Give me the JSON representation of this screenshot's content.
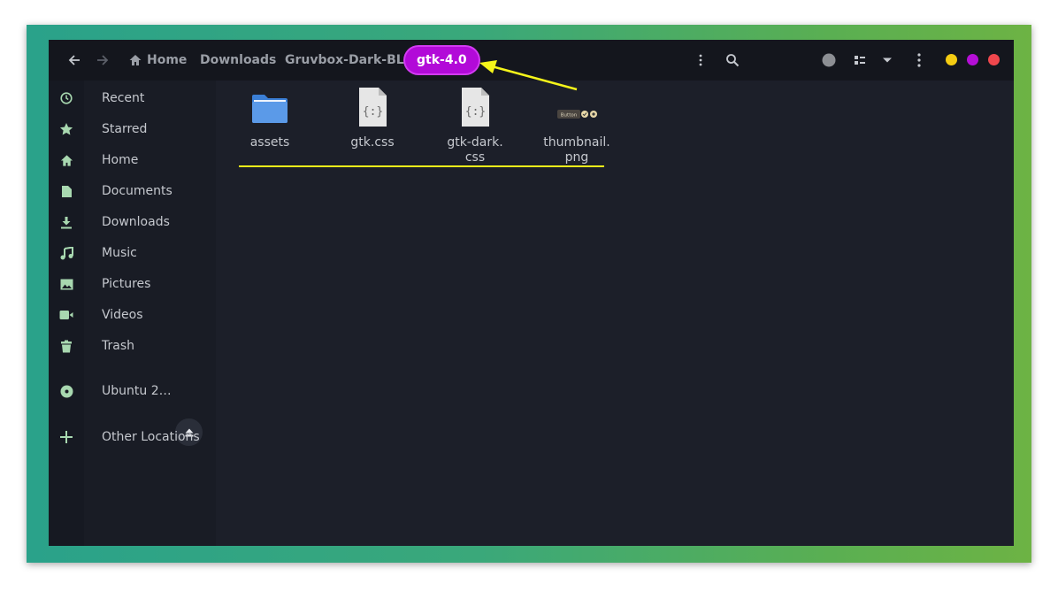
{
  "window": {
    "breadcrumbs": [
      "Home",
      "Downloads",
      "Gruvbox-Dark-BL",
      "gtk-4.0"
    ]
  },
  "headerbar": {
    "back_icon": "arrow-left-icon",
    "forward_icon": "arrow-right-icon",
    "home_icon": "home-icon",
    "path_menu_icon": "vertical-dots-icon",
    "search_icon": "search-icon",
    "view_icon": "list-view-icon",
    "sort_icon": "chevron-down-icon",
    "main_menu_icon": "vertical-dots-icon",
    "window_controls": {
      "minimize": "#f5cc12",
      "maximize": "#b50fd6",
      "close": "#f0474d"
    }
  },
  "sidebar": {
    "items": [
      {
        "label": "Recent",
        "icon": "clock-icon"
      },
      {
        "label": "Starred",
        "icon": "star-icon"
      },
      {
        "label": "Home",
        "icon": "home-icon"
      },
      {
        "label": "Documents",
        "icon": "document-icon"
      },
      {
        "label": "Downloads",
        "icon": "download-icon"
      },
      {
        "label": "Music",
        "icon": "music-icon"
      },
      {
        "label": "Pictures",
        "icon": "picture-icon"
      },
      {
        "label": "Videos",
        "icon": "video-icon"
      },
      {
        "label": "Trash",
        "icon": "trash-icon"
      }
    ],
    "devices": [
      {
        "label": "Ubuntu 2…",
        "icon": "disc-icon",
        "action_icon": "eject-icon"
      }
    ],
    "other": {
      "label": "Other Locations",
      "icon": "plus-icon"
    }
  },
  "files": [
    {
      "name": "assets",
      "icon": "folder-icon"
    },
    {
      "name": "gtk.css",
      "icon": "css-file-icon"
    },
    {
      "name": "gtk-dark.\ncss",
      "icon": "css-file-icon"
    },
    {
      "name": "thumbnail.\npng",
      "icon": "image-thumbnail-icon",
      "thumb_button_text": "Button"
    }
  ],
  "colors": {
    "accent_green": "#a8d8b0",
    "highlight_purple": "#b20ad8",
    "annotation_yellow": "#f5f51a"
  }
}
